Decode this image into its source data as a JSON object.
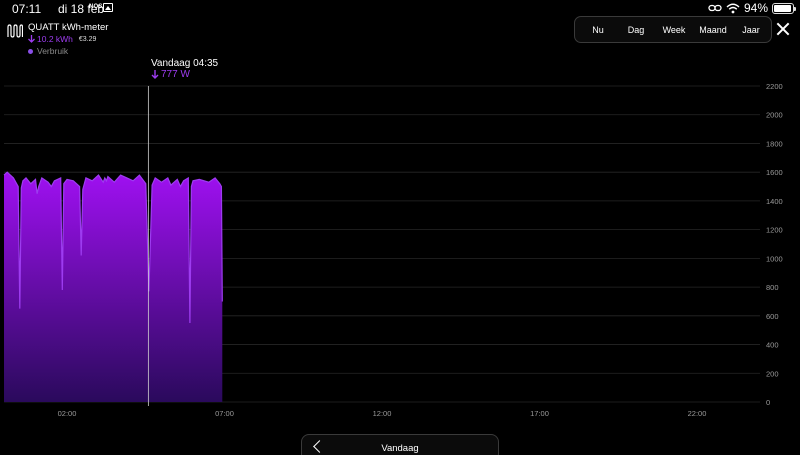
{
  "status_bar": {
    "time": "07:11",
    "date": "di 18 feb",
    "news_app": "NOS",
    "battery": "94%",
    "battery_level": 0.94
  },
  "header": {
    "title": "QUATT kWh-meter",
    "kwh_value": "10.2 kWh",
    "cost": "€3.29",
    "legend_label": "Verbruik",
    "accent_color": "#9d3cf0"
  },
  "range_selector": {
    "options": [
      "Nu",
      "Dag",
      "Week",
      "Maand",
      "Jaar"
    ],
    "selected": "Dag"
  },
  "cursor": {
    "label": "Vandaag 04:35",
    "value": "777 W",
    "time_hours": 4.583
  },
  "bottom_nav": {
    "label": "Vandaag"
  },
  "chart_data": {
    "type": "area",
    "title": "",
    "xlabel": "",
    "ylabel": "",
    "x_ticks": [
      "02:00",
      "07:00",
      "12:00",
      "17:00",
      "22:00"
    ],
    "x_tick_hours": [
      2,
      7,
      12,
      17,
      22
    ],
    "y_ticks": [
      "0",
      "200",
      "400",
      "600",
      "800",
      "1000",
      "1200",
      "1400",
      "1600",
      "1800",
      "2000",
      "2200"
    ],
    "ylim": [
      0,
      2200
    ],
    "xlim_hours": [
      0,
      24
    ],
    "grid": true,
    "series": [
      {
        "color": "#9d3cf0",
        "x_hours": [
          0.0,
          0.1,
          0.3,
          0.45,
          0.5,
          0.55,
          0.6,
          0.7,
          0.85,
          1.0,
          1.05,
          1.1,
          1.2,
          1.4,
          1.5,
          1.6,
          1.8,
          1.85,
          1.9,
          2.0,
          2.2,
          2.4,
          2.45,
          2.5,
          2.6,
          2.8,
          3.0,
          3.15,
          3.2,
          3.25,
          3.3,
          3.5,
          3.7,
          3.9,
          4.1,
          4.3,
          4.5,
          4.6,
          4.7,
          4.8,
          5.0,
          5.2,
          5.3,
          5.5,
          5.6,
          5.7,
          5.85,
          5.9,
          5.95,
          6.0,
          6.2,
          6.5,
          6.7,
          6.85,
          6.9,
          6.93
        ],
        "values": [
          1580,
          1600,
          1560,
          1500,
          650,
          1490,
          1540,
          1560,
          1520,
          1550,
          1450,
          1500,
          1560,
          1530,
          1500,
          1540,
          1560,
          780,
          1520,
          1550,
          1540,
          1500,
          1020,
          1480,
          1560,
          1540,
          1580,
          1530,
          1560,
          1540,
          1570,
          1530,
          1580,
          1560,
          1540,
          1580,
          1520,
          770,
          1510,
          1560,
          1530,
          1560,
          1510,
          1550,
          1500,
          1540,
          1560,
          550,
          1500,
          1540,
          1550,
          1530,
          1560,
          1520,
          1500,
          700
        ]
      }
    ]
  }
}
